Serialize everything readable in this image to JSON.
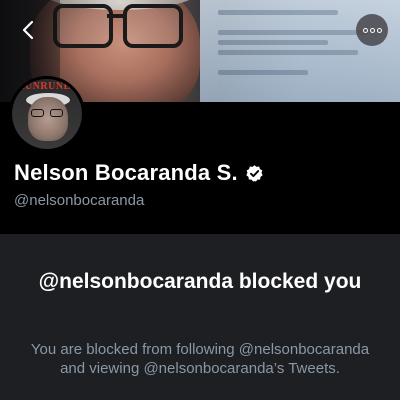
{
  "profile": {
    "name": "Nelson Bocaranda S.",
    "handle": "@nelsonbocaranda",
    "verified": true,
    "avatar_banner_text": "RUNRUNES"
  },
  "icons": {
    "back": "chevron-left-icon",
    "more": "more-options-icon",
    "verified": "verified-badge-icon"
  },
  "blocked": {
    "title": "@nelsonbocaranda blocked you",
    "description": "You are blocked from following @nelsonbocaranda and viewing @nelsonbocaranda’s Tweets."
  },
  "colors": {
    "background": "#000000",
    "panel": "#1e1f22",
    "primary_text": "#ffffff",
    "secondary_text": "#8b98a5"
  }
}
